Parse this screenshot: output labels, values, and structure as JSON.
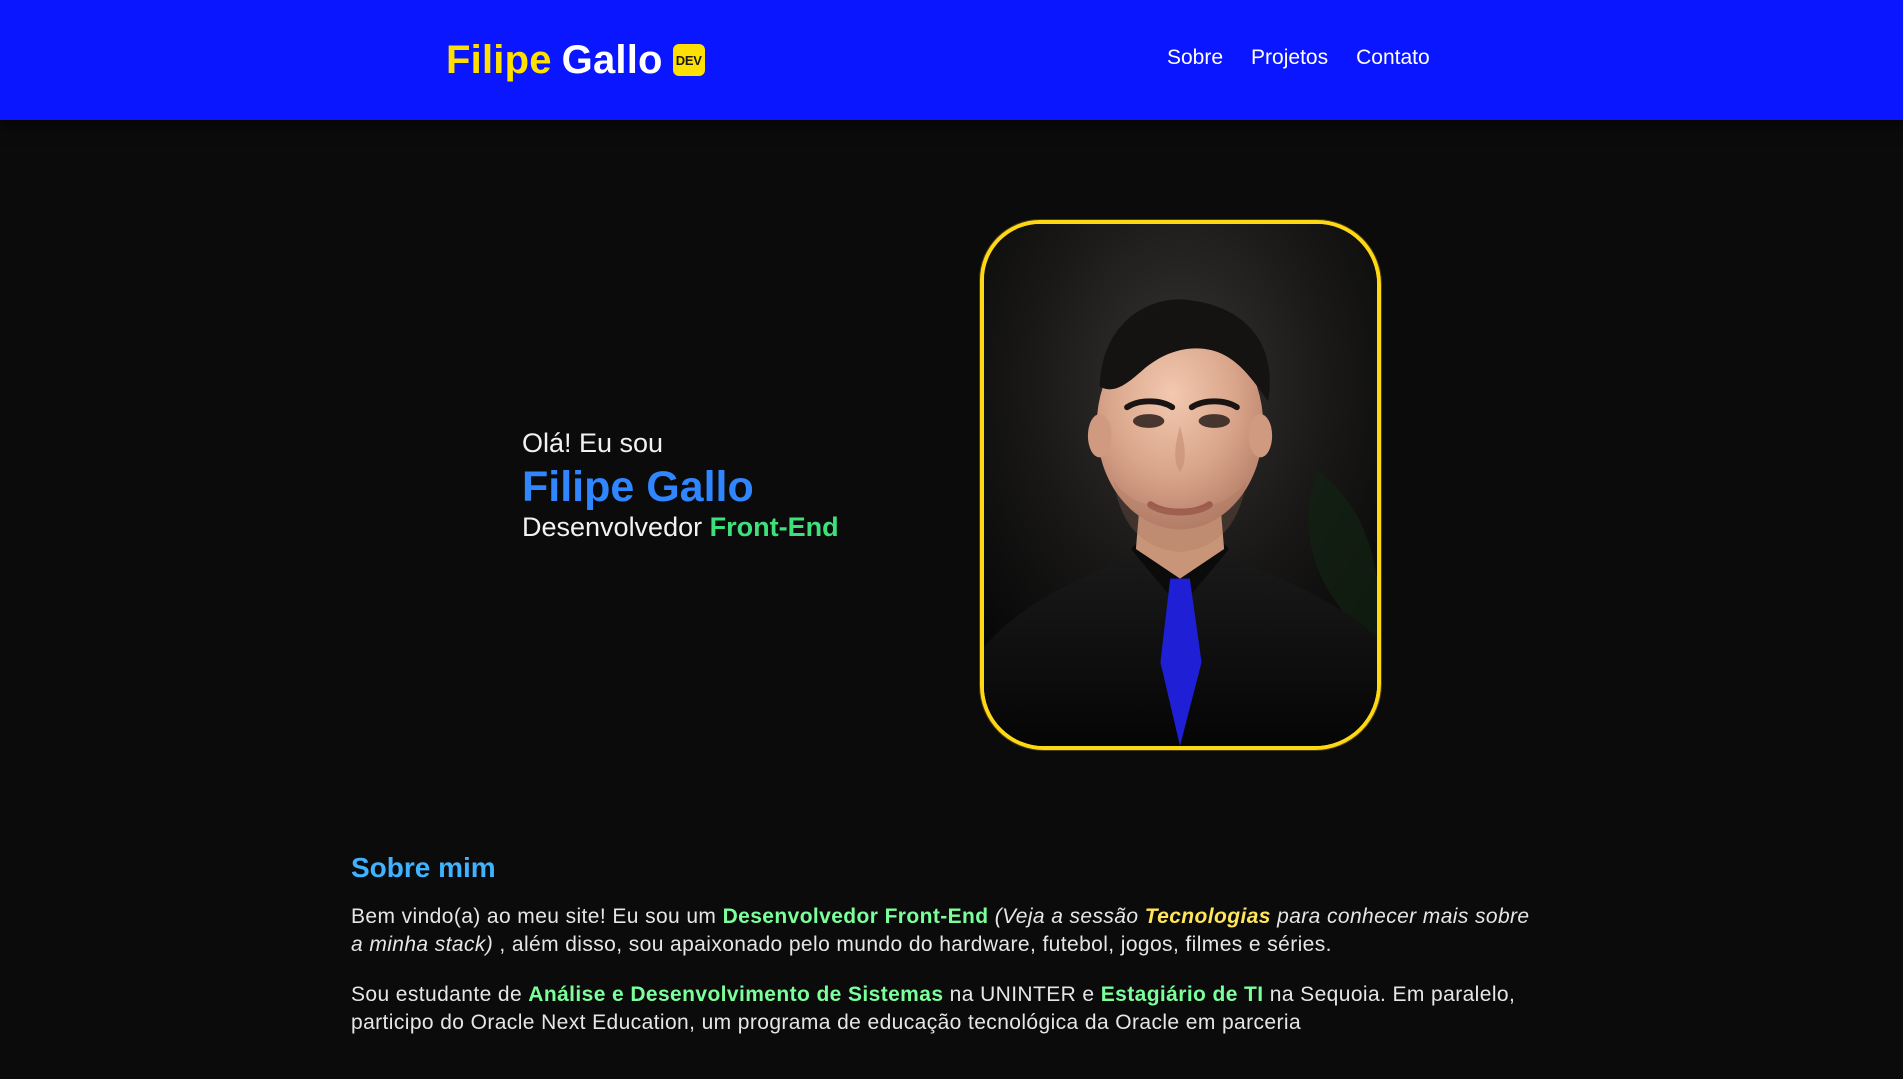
{
  "header": {
    "brand_first": "Filipe",
    "brand_last": "Gallo",
    "brand_badge": "DEV",
    "nav": [
      {
        "label": "Sobre"
      },
      {
        "label": "Projetos"
      },
      {
        "label": "Contato"
      }
    ],
    "colors": {
      "bar": "#0a16ff",
      "brand_accent": "#ffe000"
    }
  },
  "hero": {
    "greeting": "Olá! Eu sou",
    "name": "Filipe Gallo",
    "role_prefix": "Desenvolvedor",
    "role_accent": "Front-End",
    "photo_icon": "portrait-photo",
    "colors": {
      "name": "#2f86ff",
      "accent": "#3ee07c",
      "frame": "#ffd814"
    }
  },
  "about": {
    "title": "Sobre mim",
    "p1": {
      "a": "Bem vindo(a) ao meu site! Eu sou um ",
      "b": "Desenvolvedor Front-End",
      "c": " (Veja a sessão ",
      "d": "Tecnologias",
      "e": " para conhecer mais sobre a minha stack)",
      "f": ", além disso, sou apaixonado pelo mundo do hardware, futebol, jogos, filmes e séries."
    },
    "p2": {
      "a": "Sou estudante de ",
      "b": "Análise e Desenvolvimento de Sistemas",
      "c": " na UNINTER e ",
      "d": "Estagiário de TI",
      "e": " na Sequoia. Em paralelo, participo do Oracle Next Education, um programa de educação tecnológica da Oracle em parceria"
    },
    "colors": {
      "title": "#3fb3ff",
      "highlight": "#7bff9a",
      "highlight_alt": "#ffe55a"
    }
  }
}
